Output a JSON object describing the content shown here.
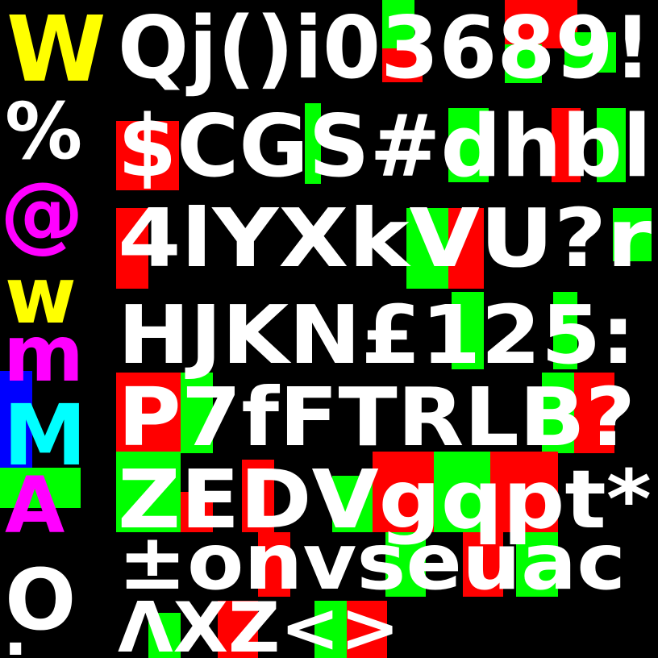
{
  "palette": {
    "background": "#000000",
    "white": "#ffffff",
    "magenta": "#ff00ff",
    "cyan": "#00ffff",
    "yellow": "#ffff00",
    "green": "#00ff00",
    "red": "#ff0000",
    "blue": "#0000ff"
  },
  "left_column": {
    "glyphs": [
      "W",
      "%",
      "@",
      "w",
      "m",
      "M",
      "A",
      "O",
      "."
    ]
  },
  "grid": {
    "rows": [
      {
        "text": "Qj()i03689!"
      },
      {
        "text": "$CGS#dhbl"
      },
      {
        "text": "4lYXkVU?r"
      },
      {
        "text": "HJKN£125:"
      },
      {
        "text": "P7fFTRLB?"
      },
      {
        "text": "ZEDVgqpt*"
      },
      {
        "text": "±onvseuac"
      },
      {
        "text": "ΛXZ<>"
      }
    ]
  }
}
